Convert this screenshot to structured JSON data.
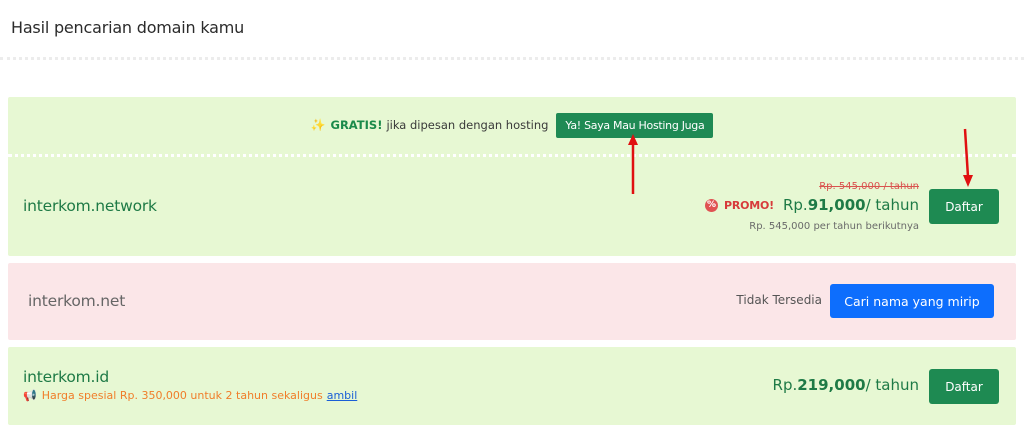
{
  "page": {
    "title": "Hasil pencarian domain kamu"
  },
  "promo_banner": {
    "gratis": "GRATIS!",
    "text": "jika dipesan dengan hosting",
    "button_label": "Ya! Saya Mau Hosting Juga"
  },
  "results": [
    {
      "domain": "interkom.network",
      "old_price": "Rp. 545,000 / tahun",
      "promo_label": "PROMO!",
      "price_prefix": "Rp.",
      "price_amount": "91,000",
      "price_suffix": "/ tahun",
      "next_price": "Rp. 545,000 per tahun berikutnya",
      "button_label": "Daftar"
    },
    {
      "domain": "interkom.net",
      "status": "Tidak Tersedia",
      "button_label": "Cari nama yang mirip"
    },
    {
      "domain": "interkom.id",
      "special_note": "Harga spesial Rp. 350,000 untuk 2 tahun sekaligus",
      "special_link": "ambil",
      "price_prefix": "Rp.",
      "price_amount": "219,000",
      "price_suffix": "/ tahun",
      "button_label": "Daftar"
    }
  ],
  "colors": {
    "available_bg": "#e7f8d3",
    "unavailable_bg": "#fbe6e8",
    "primary_green": "#1e8a52",
    "primary_blue": "#0d6efd",
    "promo_red": "#d73b3b",
    "annotation_arrow": "#e01010"
  }
}
